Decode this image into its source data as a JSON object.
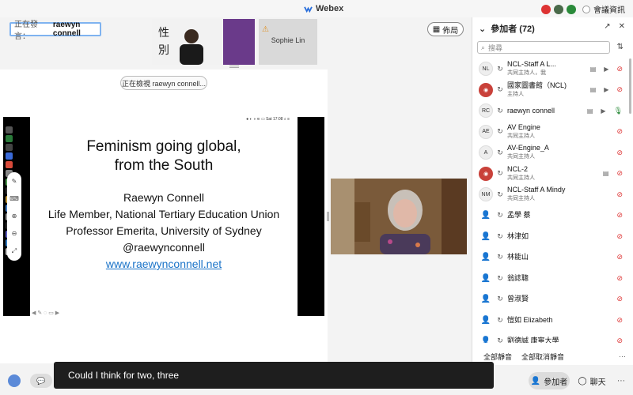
{
  "app": {
    "title": "Webex",
    "user_label": "會議資訊"
  },
  "speaker": {
    "label": "正在發言：",
    "name": "raewyn connell"
  },
  "thumbnails": [
    {
      "name": "Sophie Lin"
    }
  ],
  "layout_button": {
    "label": "佈局"
  },
  "viewing_chip": {
    "text": "正在檢視 raewyn connell..."
  },
  "slide": {
    "title": "Feminism going global,\nfrom the South",
    "name": "Raewyn Connell",
    "line1": "Life Member, National Tertiary Education Union",
    "line2": "Professor Emerita, University of Sydney",
    "handle": "@raewynconnell",
    "link": "www.raewynconnell.net"
  },
  "panel": {
    "title": "參加者 (72)",
    "search_placeholder": "搜尋",
    "participants": [
      {
        "initials": "NL",
        "name": "NCL-Staff A L...",
        "role": "共同主持人，我",
        "avatar": "ini",
        "mic": "off",
        "share": true,
        "cam": true
      },
      {
        "initials": "",
        "name": "國家圖書館（NCL)",
        "role": "主持人",
        "avatar": "img",
        "mic": "off",
        "share": true,
        "cam": true
      },
      {
        "initials": "RC",
        "name": "raewyn connell",
        "role": "",
        "avatar": "ini",
        "mic": "on",
        "share": true,
        "cam": true
      },
      {
        "initials": "AE",
        "name": "AV Engine",
        "role": "共同主持人",
        "avatar": "ini",
        "mic": "off",
        "share": false,
        "cam": false
      },
      {
        "initials": "A",
        "name": "AV-Engine_A",
        "role": "共同主持人",
        "avatar": "ini",
        "mic": "off",
        "share": false,
        "cam": false
      },
      {
        "initials": "",
        "name": "NCL-2",
        "role": "共同主持人",
        "avatar": "img",
        "mic": "off",
        "share": true,
        "cam": false
      },
      {
        "initials": "NM",
        "name": "NCL-Staff A Mindy",
        "role": "共同主持人",
        "avatar": "ini",
        "mic": "off",
        "share": false,
        "cam": false
      },
      {
        "initials": "",
        "name": "孟學 蔡",
        "role": "",
        "avatar": "person",
        "mic": "off",
        "share": false,
        "cam": false
      },
      {
        "initials": "",
        "name": "林津如",
        "role": "",
        "avatar": "person",
        "mic": "off",
        "share": false,
        "cam": false
      },
      {
        "initials": "",
        "name": "林能山",
        "role": "",
        "avatar": "person",
        "mic": "off",
        "share": false,
        "cam": false
      },
      {
        "initials": "",
        "name": "翁誌聰",
        "role": "",
        "avatar": "person",
        "mic": "off",
        "share": false,
        "cam": false
      },
      {
        "initials": "",
        "name": "曾淑賢",
        "role": "",
        "avatar": "person",
        "mic": "off",
        "share": false,
        "cam": false
      },
      {
        "initials": "",
        "name": "愷如 Elizabeth",
        "role": "",
        "avatar": "person",
        "mic": "off",
        "share": false,
        "cam": false
      },
      {
        "initials": "",
        "name": "劉德誠 康寧大學",
        "role": "",
        "avatar": "person",
        "mic": "off",
        "share": false,
        "cam": false
      }
    ],
    "footer": {
      "mute_all": "全部靜音",
      "unmute_all": "全部取消靜音",
      "more": "···"
    }
  },
  "caption": {
    "text": "Could I think for two, three"
  },
  "bottom": {
    "participants_label": "參加者",
    "chat_label": "聊天"
  }
}
